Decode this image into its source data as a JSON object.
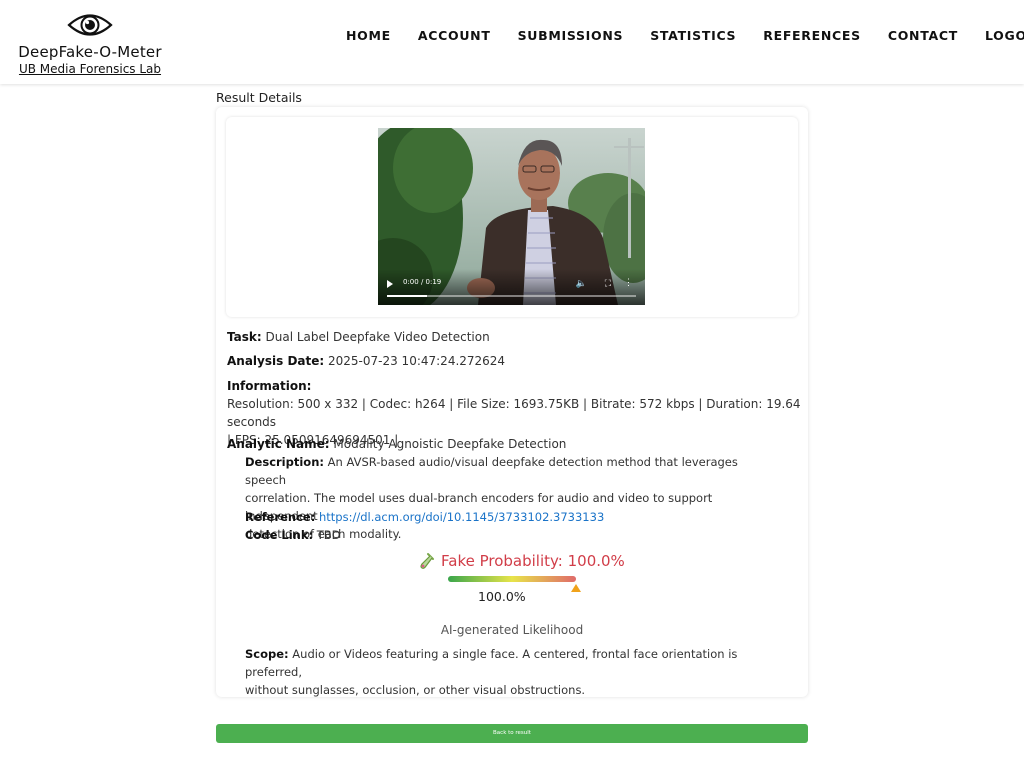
{
  "brand": {
    "title": "DeepFake-O-Meter",
    "subtitle": "UB Media Forensics Lab",
    "icon": "eye-icon"
  },
  "nav": {
    "items": [
      {
        "label": "HOME"
      },
      {
        "label": "ACCOUNT"
      },
      {
        "label": "SUBMISSIONS"
      },
      {
        "label": "STATISTICS"
      },
      {
        "label": "REFERENCES"
      },
      {
        "label": "CONTACT"
      },
      {
        "label": "LOGOUT"
      }
    ]
  },
  "page": {
    "section_title": "Result Details"
  },
  "video": {
    "time": "0:00 / 0:19",
    "progress": 0.16,
    "icons": [
      "play-icon",
      "volume-icon",
      "fullscreen-icon",
      "more-options-icon"
    ]
  },
  "details": {
    "task_label": "Task:",
    "task_value": "Dual Label Deepfake Video Detection",
    "date_label": "Analysis Date:",
    "date_value": "2025-07-23 10:47:24.272624",
    "info_label": "Information:",
    "info_line1": "Resolution: 500 x 332 | Codec: h264 | File Size: 1693.75KB | Bitrate: 572 kbps | Duration: 19.64 seconds",
    "info_line2": "| FPS: 25.05091649694501 |",
    "analytic_label": "Analytic Name:",
    "analytic_value": "Modality Agnoistic Deepfake Detection",
    "description_label": "Description:",
    "description_line1": "An AVSR-based audio/visual deepfake detection method that leverages speech",
    "description_line2": "correlation. The model uses dual-branch encoders for audio and video to support independent",
    "description_line3": "detection of each modality.",
    "reference_label": "Reference:",
    "reference_value": "https://dl.acm.org/doi/10.1145/3733102.3733133",
    "code_label": "Code Link:",
    "code_value": "TBD",
    "scope_label": "Scope:",
    "scope_line1": "Audio or Videos featuring a single face. A centered, frontal face orientation is preferred,",
    "scope_line2": "without sunglasses, occlusion, or other visual obstructions."
  },
  "result": {
    "probability_text": "Fake Probability: 100.0%",
    "gauge_value_text": "100.0%",
    "gauge_level": 1.0,
    "likelihood_label": "AI-generated Likelihood",
    "icon": "test-tube-icon",
    "colors": {
      "probability": "#d13d48",
      "marker": "#f0a21b"
    }
  },
  "actions": {
    "back_label": "Back to result",
    "button_color": "#4caf50"
  }
}
